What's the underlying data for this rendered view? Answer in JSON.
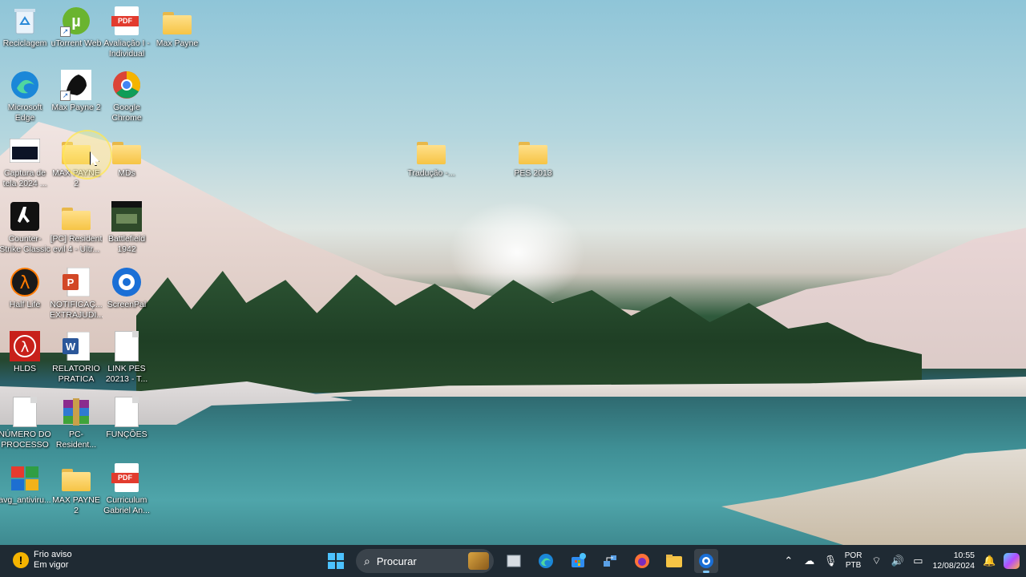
{
  "desktop": {
    "icons": [
      {
        "name": "recycle-bin-icon",
        "label": "Reciclagem",
        "type": "recycle"
      },
      {
        "name": "utorrent-web-icon",
        "label": "uTorrent Web",
        "type": "utorrent"
      },
      {
        "name": "pdf-avaliacao-icon",
        "label": "Avaliação I - Individual",
        "type": "pdf"
      },
      {
        "name": "folder-max-payne-icon",
        "label": "Max Payne",
        "type": "folder"
      },
      {
        "name": "edge-icon",
        "label": "Microsoft Edge",
        "type": "edge"
      },
      {
        "name": "max-payne-2-game-icon",
        "label": "Max Payne 2",
        "type": "game"
      },
      {
        "name": "chrome-icon",
        "label": "Google Chrome",
        "type": "chrome"
      },
      {
        "name": "screenshot-file-icon",
        "label": "Captura de tela 2024 ...",
        "type": "screenshot"
      },
      {
        "name": "folder-max-payne-2-icon",
        "label": "MAX PAYNE 2",
        "type": "folder"
      },
      {
        "name": "folder-mds-icon",
        "label": "MDs",
        "type": "folder"
      },
      {
        "name": "counter-strike-icon",
        "label": "Counter-Strike Classic",
        "type": "cs"
      },
      {
        "name": "folder-resident-evil-icon",
        "label": "[PC] Resident evil 4 - Ultr...",
        "type": "folder"
      },
      {
        "name": "battlefield-icon",
        "label": "Battlefield 1942",
        "type": "battlefield"
      },
      {
        "name": "half-life-icon",
        "label": "Half Life",
        "type": "halflife"
      },
      {
        "name": "powerpoint-file-icon",
        "label": "NOTIFICAÇ... EXTRAJUDI...",
        "type": "ppt"
      },
      {
        "name": "screenpal-icon",
        "label": "ScreenPal",
        "type": "screenpal"
      },
      {
        "name": "hlds-icon",
        "label": "HLDS",
        "type": "hlds"
      },
      {
        "name": "word-file-icon",
        "label": "RELATORIO PRATICA IN...",
        "type": "word"
      },
      {
        "name": "text-file-link-pes-icon",
        "label": "LINK PES 20213 - T...",
        "type": "doc"
      },
      {
        "name": "text-file-numero-icon",
        "label": "NÚMERO DO PROCESSO ...",
        "type": "doc"
      },
      {
        "name": "rar-file-icon",
        "label": "PC-Resident...",
        "type": "rar"
      },
      {
        "name": "text-file-funcoes-icon",
        "label": "FUNÇÕES",
        "type": "doc"
      },
      {
        "name": "avg-antivirus-icon",
        "label": "avg_antiviru...",
        "type": "avg"
      },
      {
        "name": "zip-max-payne-2-icon",
        "label": "MAX PAYNE 2",
        "type": "zip"
      },
      {
        "name": "pdf-curriculum-icon",
        "label": "Curriculum Gabriel An...",
        "type": "pdf"
      },
      {
        "name": "folder-traducao-icon",
        "label": "Tradução -...",
        "type": "folder"
      },
      {
        "name": "folder-pes-2013-icon",
        "label": "PES 2013",
        "type": "folder"
      }
    ]
  },
  "taskbar": {
    "weather_title": "Frio aviso",
    "weather_subtitle": "Em vigor",
    "search_placeholder": "Procurar",
    "language_top": "POR",
    "language_bottom": "PTB",
    "time": "10:55",
    "date": "12/08/2024"
  }
}
